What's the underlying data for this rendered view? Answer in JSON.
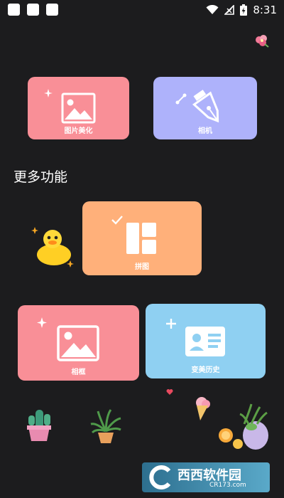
{
  "status_bar": {
    "time": "8:31",
    "icons": [
      "notification-square-icon",
      "notification-square-icon",
      "notification-square-icon",
      "wifi-icon",
      "no-signal-icon",
      "battery-charging-icon"
    ]
  },
  "top_cards": [
    {
      "label": "图片美化",
      "color": "#f98f97",
      "icon": "image-icon"
    },
    {
      "label": "相机",
      "color": "#aeb2fb",
      "icon": "pen-nib-icon"
    }
  ],
  "section_title": "更多功能",
  "more_cards": [
    {
      "label": "拼图",
      "color": "#ffb07a",
      "icon": "collage-layout-icon"
    },
    {
      "label": "相框",
      "color": "#f98f97",
      "icon": "image-icon"
    },
    {
      "label": "变美历史",
      "color": "#8fd0f2",
      "icon": "id-card-icon"
    }
  ],
  "watermark": {
    "main": "西西软件园",
    "sub": "CR173.com"
  }
}
